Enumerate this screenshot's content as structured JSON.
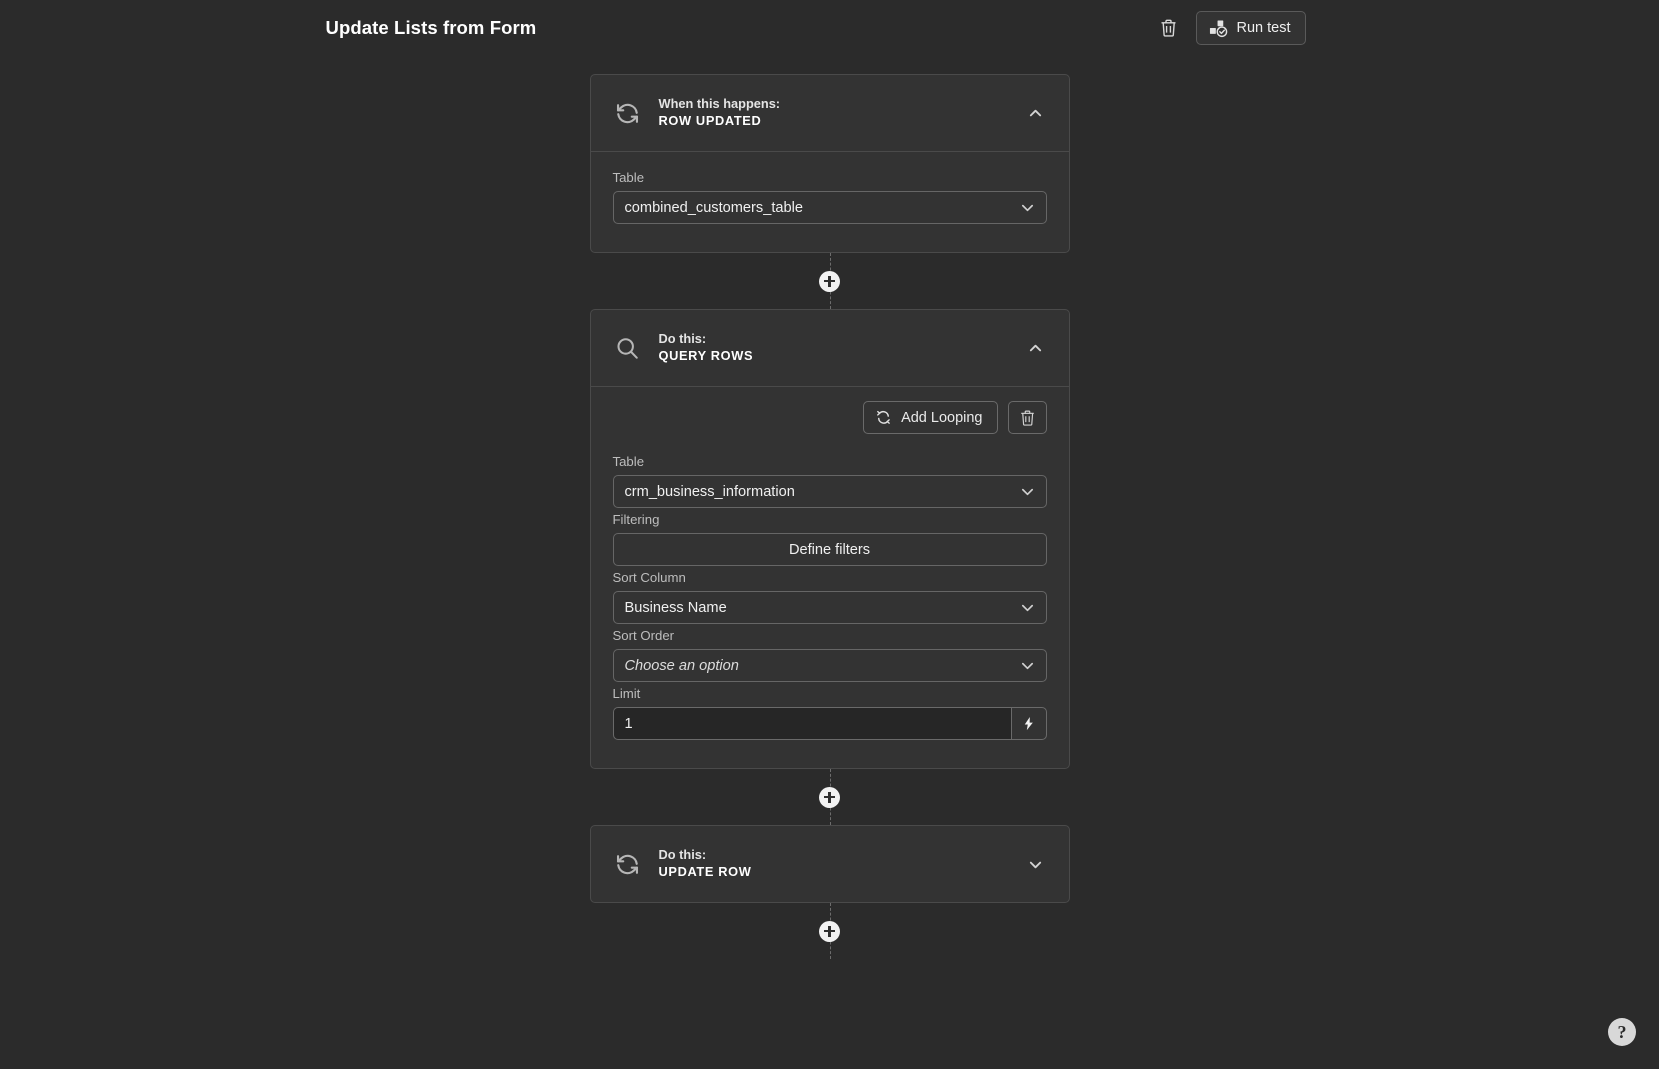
{
  "header": {
    "title": "Update Lists from Form",
    "delete_icon": "trash-icon",
    "run_test_label": "Run test",
    "run_test_icon": "test-blocks-check-icon"
  },
  "colors": {
    "page_background": "#2b2b2b",
    "card_background": "#333333",
    "card_border": "#4a4a4a",
    "input_border": "#666666",
    "input_background_dark": "#262626",
    "text_primary": "#f0f0f0",
    "text_muted": "#bdbdbd",
    "node_fill": "#f2f2f2"
  },
  "steps": [
    {
      "kicker": "When this happens:",
      "name": "ROW UPDATED",
      "icon": "refresh-sync-icon",
      "expanded": true,
      "chevron": "chevron-up-icon",
      "fields": [
        {
          "label": "Table",
          "type": "select",
          "value": "combined_customers_table",
          "is_placeholder": false,
          "caret": "chevron-down-icon"
        }
      ]
    },
    {
      "kicker": "Do this:",
      "name": "QUERY ROWS",
      "icon": "magnifier-search-icon",
      "expanded": true,
      "chevron": "chevron-up-icon",
      "toolbar": {
        "looping_label": "Add Looping",
        "looping_icon": "loop-arrows-icon",
        "delete_icon": "trash-icon"
      },
      "fields": [
        {
          "label": "Table",
          "type": "select",
          "value": "crm_business_information",
          "is_placeholder": false,
          "caret": "chevron-down-icon"
        },
        {
          "label": "Filtering",
          "type": "button",
          "value": "Define filters"
        },
        {
          "label": "Sort Column",
          "type": "select",
          "value": "Business Name",
          "is_placeholder": false,
          "caret": "chevron-down-icon"
        },
        {
          "label": "Sort Order",
          "type": "select",
          "value": "Choose an option",
          "is_placeholder": true,
          "caret": "chevron-down-icon"
        },
        {
          "label": "Limit",
          "type": "input",
          "value": "1",
          "placeholder": "",
          "binding_icon": "lightning-bolt-icon"
        }
      ]
    },
    {
      "kicker": "Do this:",
      "name": "UPDATE ROW",
      "icon": "refresh-sync-icon",
      "expanded": false,
      "chevron": "chevron-down-icon",
      "fields": []
    }
  ],
  "connectors": [
    {
      "icon": "plus-node-icon"
    },
    {
      "icon": "plus-node-icon"
    },
    {
      "icon": "plus-node-icon"
    }
  ],
  "help": {
    "label": "?",
    "icon": "help-question-icon"
  }
}
